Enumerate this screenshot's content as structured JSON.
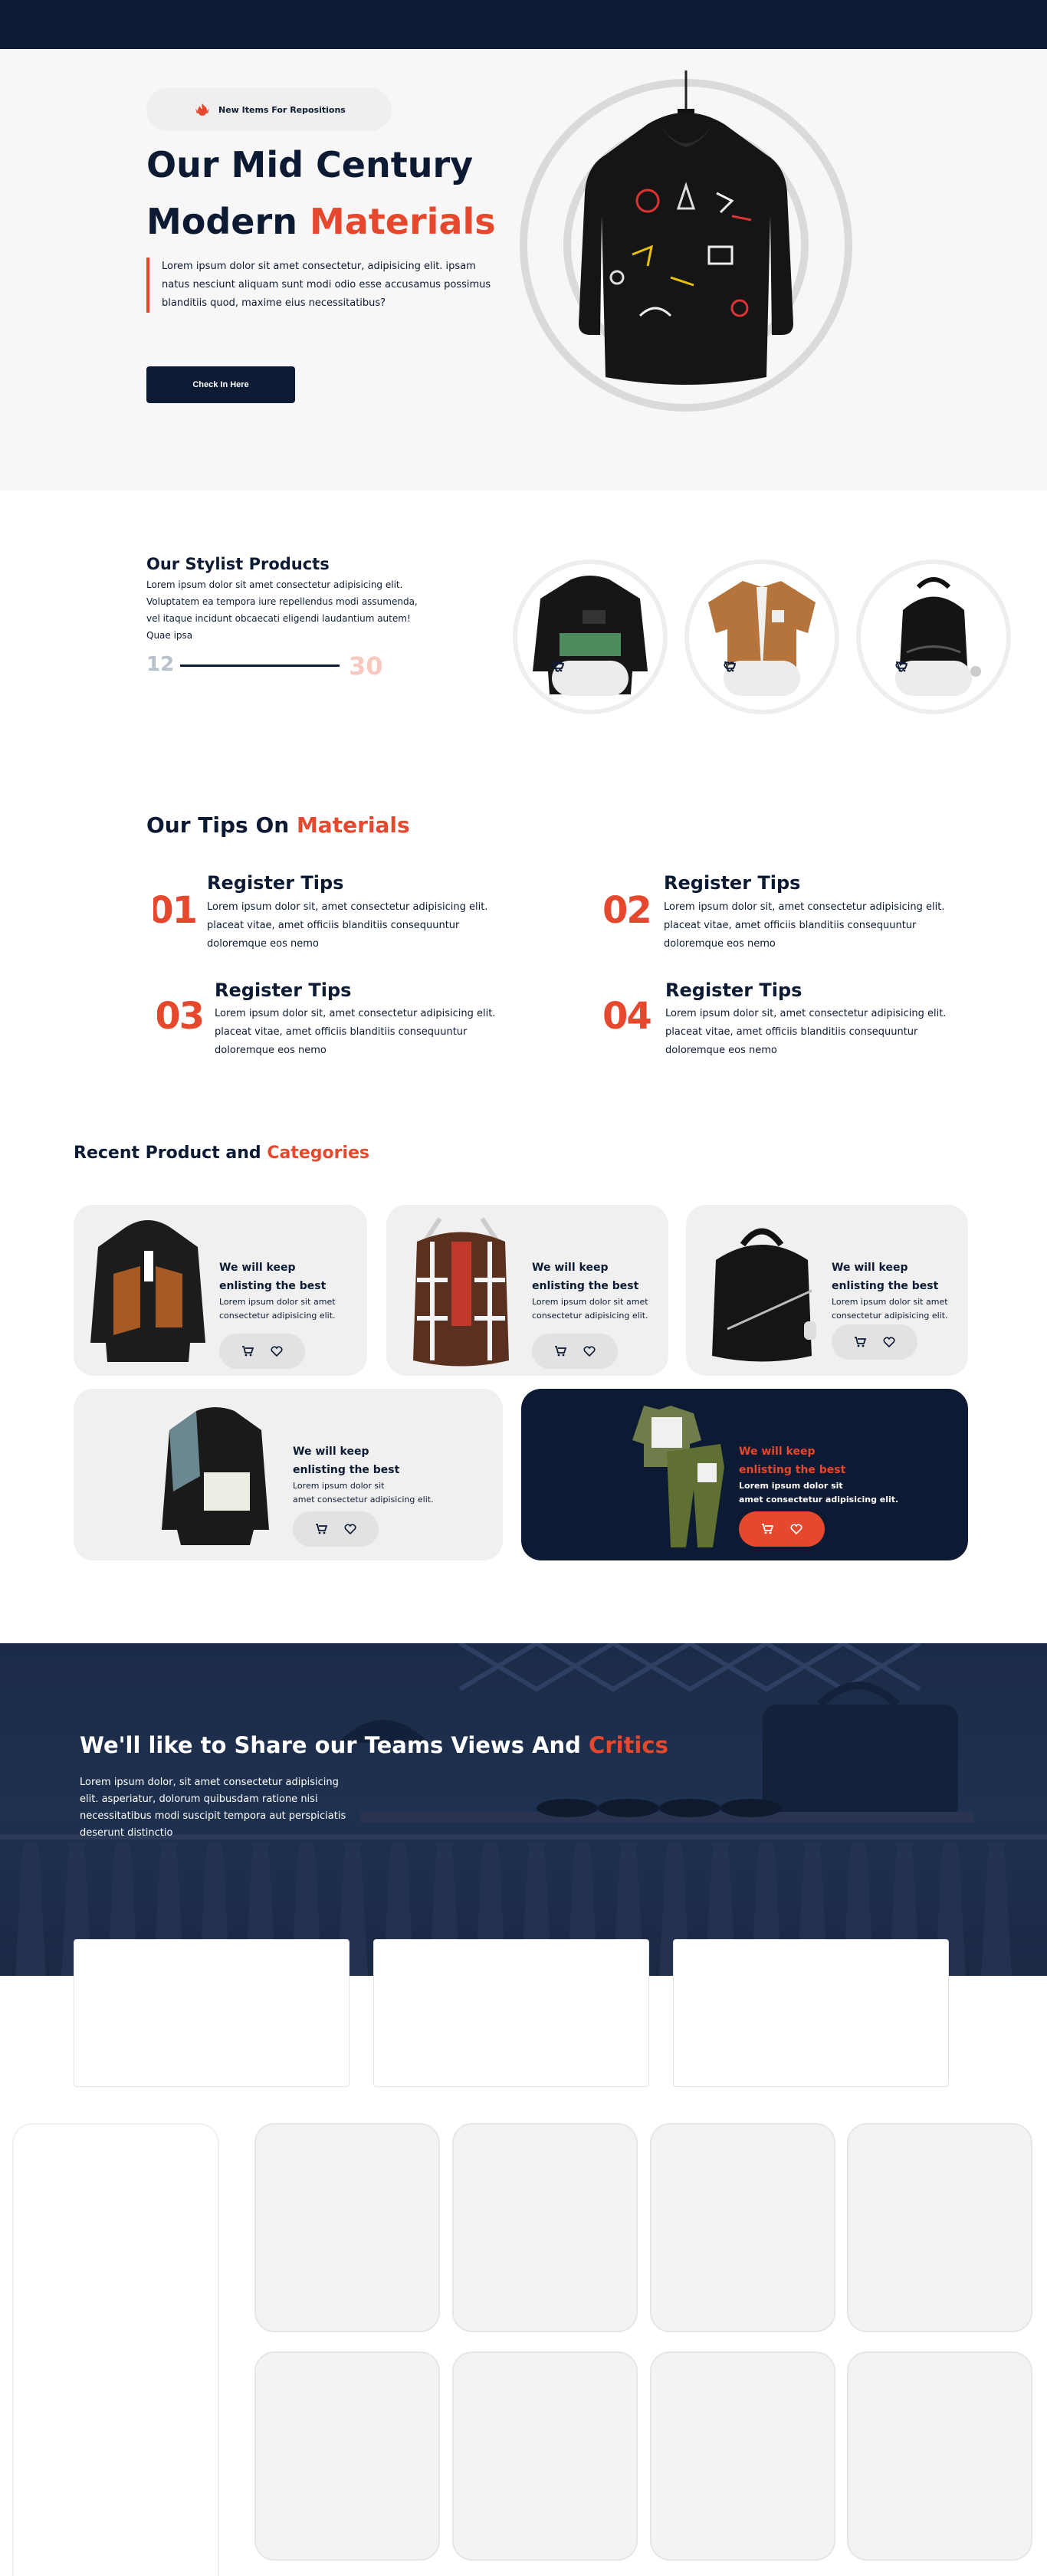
{
  "colors": {
    "navy": "#0c1b33",
    "accent": "#e6482e",
    "light_bg": "#f7f7f7",
    "card_bg": "#f0f0f0"
  },
  "hero": {
    "badge": "New Items For Repositions",
    "badge_icon": "flame-icon",
    "title_line1": "Our Mid Century",
    "title_line2_plain": "Modern",
    "title_line2_accent": "Materials",
    "description": "Lorem ipsum dolor sit amet consectetur, adipisicing elit. ipsam natus nesciunt aliquam sunt modi odio esse accusamus possimus blanditiis quod, maxime eius necessitatibus?",
    "button": "Check In Here"
  },
  "stylist": {
    "title": "Our Stylist Products",
    "description": "Lorem ipsum dolor sit amet consectetur adipisicing elit. Voluptatem ea tempora iure repellendus modi assumenda, vel itaque incidunt obcaecati eligendi laudantium autem! Quae ipsa",
    "counter_current": "12",
    "counter_total": "30"
  },
  "tips": {
    "title_plain": "Our Tips On",
    "title_accent": "Materials",
    "items": [
      {
        "num": "01",
        "title": "Register Tips",
        "body": "Lorem ipsum dolor sit, amet consectetur adipisicing elit. placeat vitae, amet officiis blanditiis consequuntur doloremque eos nemo"
      },
      {
        "num": "02",
        "title": "Register Tips",
        "body": "Lorem ipsum dolor sit, amet consectetur adipisicing elit. placeat vitae, amet officiis blanditiis consequuntur doloremque eos nemo"
      },
      {
        "num": "03",
        "title": "Register Tips",
        "body": "Lorem ipsum dolor sit, amet consectetur adipisicing elit. placeat vitae, amet officiis blanditiis consequuntur doloremque eos nemo"
      },
      {
        "num": "04",
        "title": "Register Tips",
        "body": "Lorem ipsum dolor sit, amet consectetur adipisicing elit. placeat vitae, amet officiis blanditiis consequuntur doloremque eos nemo"
      }
    ]
  },
  "recent": {
    "title_plain": "Recent Product and",
    "title_accent": "Categories",
    "cards": [
      {
        "title_l1": "We will keep",
        "title_l2": "enlisting the best",
        "desc_l1": "Lorem ipsum dolor sit amet",
        "desc_l2": "consectetur adipisicing elit."
      },
      {
        "title_l1": "We will keep",
        "title_l2": "enlisting the best",
        "desc_l1": "Lorem ipsum dolor sit amet",
        "desc_l2": "consectetur adipisicing elit."
      },
      {
        "title_l1": "We will keep",
        "title_l2": "enlisting the best",
        "desc_l1": "Lorem ipsum dolor sit amet",
        "desc_l2": "consectetur adipisicing elit."
      },
      {
        "title_l1": "We will keep",
        "title_l2": "enlisting the best",
        "desc_l1": "Lorem ipsum dolor sit",
        "desc_l2": "amet consectetur adipisicing elit."
      },
      {
        "title_l1": "We will keep",
        "title_l2": "enlisting the best",
        "desc_l1": "Lorem ipsum dolor sit",
        "desc_l2": "amet consectetur adipisicing elit."
      }
    ]
  },
  "views": {
    "title_plain": "We'll like to Share our Teams Views And",
    "title_accent": "Critics",
    "description": "Lorem ipsum dolor, sit amet consectetur adipisicing elit. asperiatur, dolorum quibusdam ratione nisi necessitatibus modi suscipit tempora aut perspiciatis deserunt distinctio"
  },
  "icons": {
    "cart": "cart-icon",
    "heart": "heart-icon"
  }
}
